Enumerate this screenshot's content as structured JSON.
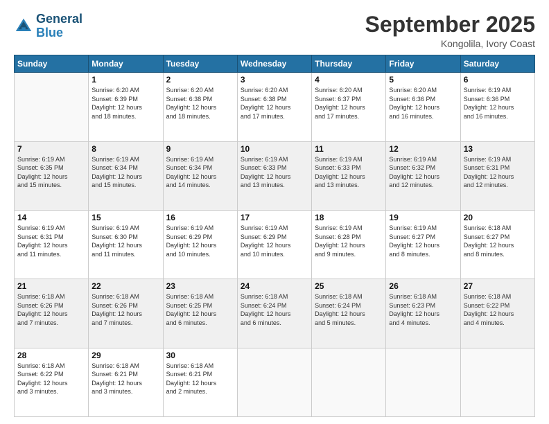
{
  "logo": {
    "line1": "General",
    "line2": "Blue"
  },
  "title": "September 2025",
  "subtitle": "Kongolila, Ivory Coast",
  "days_header": [
    "Sunday",
    "Monday",
    "Tuesday",
    "Wednesday",
    "Thursday",
    "Friday",
    "Saturday"
  ],
  "weeks": [
    [
      {
        "day": "",
        "info": ""
      },
      {
        "day": "1",
        "info": "Sunrise: 6:20 AM\nSunset: 6:39 PM\nDaylight: 12 hours\nand 18 minutes."
      },
      {
        "day": "2",
        "info": "Sunrise: 6:20 AM\nSunset: 6:38 PM\nDaylight: 12 hours\nand 18 minutes."
      },
      {
        "day": "3",
        "info": "Sunrise: 6:20 AM\nSunset: 6:38 PM\nDaylight: 12 hours\nand 17 minutes."
      },
      {
        "day": "4",
        "info": "Sunrise: 6:20 AM\nSunset: 6:37 PM\nDaylight: 12 hours\nand 17 minutes."
      },
      {
        "day": "5",
        "info": "Sunrise: 6:20 AM\nSunset: 6:36 PM\nDaylight: 12 hours\nand 16 minutes."
      },
      {
        "day": "6",
        "info": "Sunrise: 6:19 AM\nSunset: 6:36 PM\nDaylight: 12 hours\nand 16 minutes."
      }
    ],
    [
      {
        "day": "7",
        "info": "Sunrise: 6:19 AM\nSunset: 6:35 PM\nDaylight: 12 hours\nand 15 minutes."
      },
      {
        "day": "8",
        "info": "Sunrise: 6:19 AM\nSunset: 6:34 PM\nDaylight: 12 hours\nand 15 minutes."
      },
      {
        "day": "9",
        "info": "Sunrise: 6:19 AM\nSunset: 6:34 PM\nDaylight: 12 hours\nand 14 minutes."
      },
      {
        "day": "10",
        "info": "Sunrise: 6:19 AM\nSunset: 6:33 PM\nDaylight: 12 hours\nand 13 minutes."
      },
      {
        "day": "11",
        "info": "Sunrise: 6:19 AM\nSunset: 6:33 PM\nDaylight: 12 hours\nand 13 minutes."
      },
      {
        "day": "12",
        "info": "Sunrise: 6:19 AM\nSunset: 6:32 PM\nDaylight: 12 hours\nand 12 minutes."
      },
      {
        "day": "13",
        "info": "Sunrise: 6:19 AM\nSunset: 6:31 PM\nDaylight: 12 hours\nand 12 minutes."
      }
    ],
    [
      {
        "day": "14",
        "info": "Sunrise: 6:19 AM\nSunset: 6:31 PM\nDaylight: 12 hours\nand 11 minutes."
      },
      {
        "day": "15",
        "info": "Sunrise: 6:19 AM\nSunset: 6:30 PM\nDaylight: 12 hours\nand 11 minutes."
      },
      {
        "day": "16",
        "info": "Sunrise: 6:19 AM\nSunset: 6:29 PM\nDaylight: 12 hours\nand 10 minutes."
      },
      {
        "day": "17",
        "info": "Sunrise: 6:19 AM\nSunset: 6:29 PM\nDaylight: 12 hours\nand 10 minutes."
      },
      {
        "day": "18",
        "info": "Sunrise: 6:19 AM\nSunset: 6:28 PM\nDaylight: 12 hours\nand 9 minutes."
      },
      {
        "day": "19",
        "info": "Sunrise: 6:19 AM\nSunset: 6:27 PM\nDaylight: 12 hours\nand 8 minutes."
      },
      {
        "day": "20",
        "info": "Sunrise: 6:18 AM\nSunset: 6:27 PM\nDaylight: 12 hours\nand 8 minutes."
      }
    ],
    [
      {
        "day": "21",
        "info": "Sunrise: 6:18 AM\nSunset: 6:26 PM\nDaylight: 12 hours\nand 7 minutes."
      },
      {
        "day": "22",
        "info": "Sunrise: 6:18 AM\nSunset: 6:26 PM\nDaylight: 12 hours\nand 7 minutes."
      },
      {
        "day": "23",
        "info": "Sunrise: 6:18 AM\nSunset: 6:25 PM\nDaylight: 12 hours\nand 6 minutes."
      },
      {
        "day": "24",
        "info": "Sunrise: 6:18 AM\nSunset: 6:24 PM\nDaylight: 12 hours\nand 6 minutes."
      },
      {
        "day": "25",
        "info": "Sunrise: 6:18 AM\nSunset: 6:24 PM\nDaylight: 12 hours\nand 5 minutes."
      },
      {
        "day": "26",
        "info": "Sunrise: 6:18 AM\nSunset: 6:23 PM\nDaylight: 12 hours\nand 4 minutes."
      },
      {
        "day": "27",
        "info": "Sunrise: 6:18 AM\nSunset: 6:22 PM\nDaylight: 12 hours\nand 4 minutes."
      }
    ],
    [
      {
        "day": "28",
        "info": "Sunrise: 6:18 AM\nSunset: 6:22 PM\nDaylight: 12 hours\nand 3 minutes."
      },
      {
        "day": "29",
        "info": "Sunrise: 6:18 AM\nSunset: 6:21 PM\nDaylight: 12 hours\nand 3 minutes."
      },
      {
        "day": "30",
        "info": "Sunrise: 6:18 AM\nSunset: 6:21 PM\nDaylight: 12 hours\nand 2 minutes."
      },
      {
        "day": "",
        "info": ""
      },
      {
        "day": "",
        "info": ""
      },
      {
        "day": "",
        "info": ""
      },
      {
        "day": "",
        "info": ""
      }
    ]
  ]
}
